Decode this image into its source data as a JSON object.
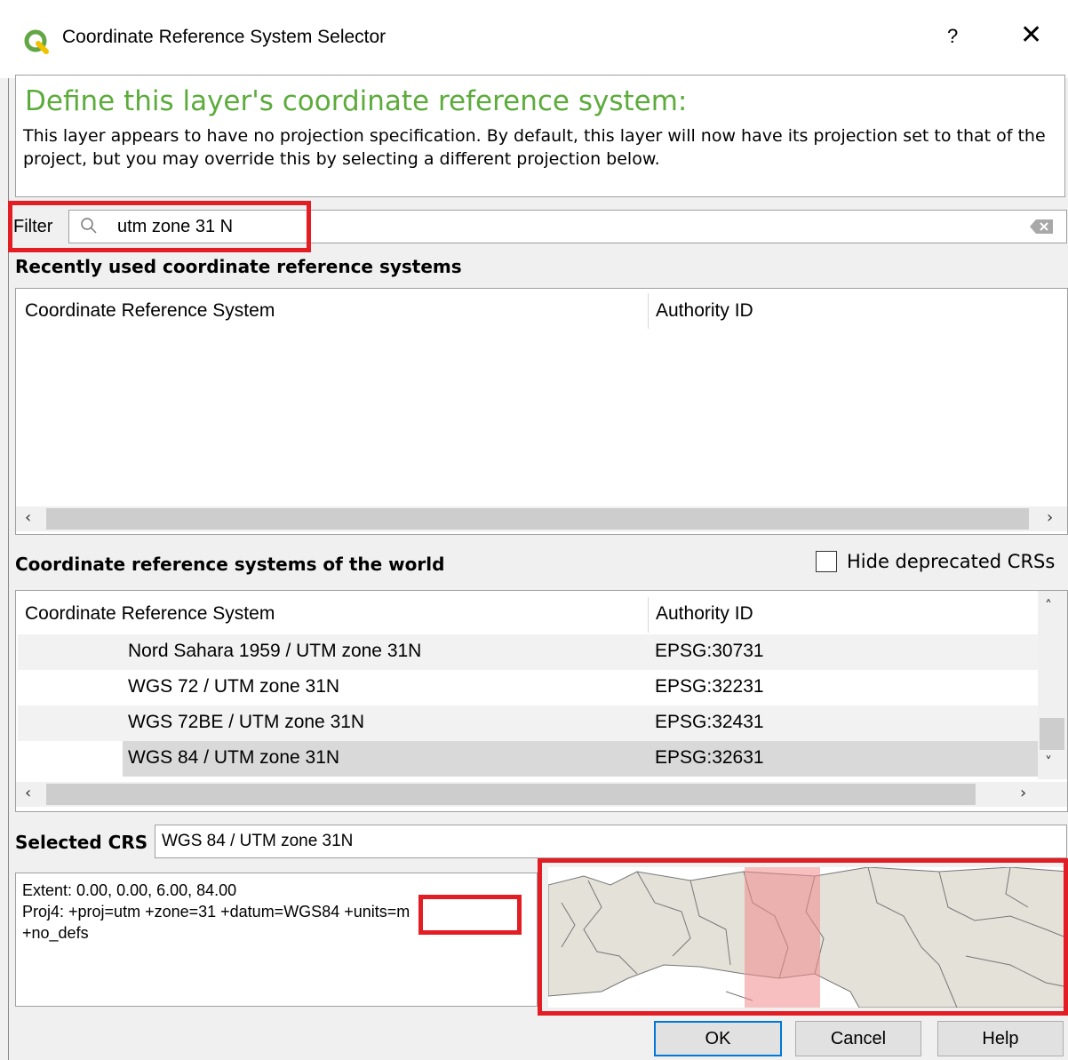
{
  "window": {
    "title": "Coordinate Reference System Selector",
    "help_label": "?",
    "close_label": "✕"
  },
  "message": {
    "title": "Define this layer's coordinate reference system:",
    "body": "This layer appears to have no projection specification. By default, this layer will now have its projection set to that of the project, but you may override this by selecting a different projection below."
  },
  "filter": {
    "label": "Filter",
    "value": "utm zone 31 N"
  },
  "recent": {
    "section_label": "Recently used coordinate reference systems",
    "columns": [
      "Coordinate Reference System",
      "Authority ID"
    ]
  },
  "world": {
    "section_label": "Coordinate reference systems of the world",
    "hide_deprecated_label": "Hide deprecated CRSs",
    "hide_deprecated_checked": false,
    "columns": [
      "Coordinate Reference System",
      "Authority ID"
    ],
    "rows": [
      {
        "name": "Nord Sahara 1959 / UTM zone 31N",
        "id": "EPSG:30731"
      },
      {
        "name": "WGS 72 / UTM zone 31N",
        "id": "EPSG:32231"
      },
      {
        "name": "WGS 72BE / UTM zone 31N",
        "id": "EPSG:32431"
      },
      {
        "name": "WGS 84 / UTM zone 31N",
        "id": "EPSG:32631"
      }
    ],
    "selected_index": 3
  },
  "selected_crs": {
    "label": "Selected CRS",
    "value": "WGS 84 / UTM zone 31N"
  },
  "info": {
    "extent": "Extent: 0.00, 0.00, 6.00, 84.00",
    "proj4_prefix": "Proj4: +proj=utm +zone=31 +datum=WGS84 ",
    "proj4_units": "+units=m",
    "proj4_suffix": "+no_defs"
  },
  "buttons": {
    "ok": "OK",
    "cancel": "Cancel",
    "help": "Help"
  },
  "colors": {
    "accent_green": "#5cab3b",
    "highlight_red": "#e21d23",
    "map_land": "#e4e1d9",
    "map_extent": "#f08a8a"
  }
}
